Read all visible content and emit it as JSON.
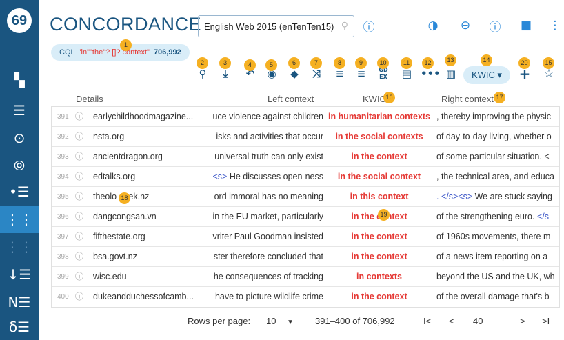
{
  "sidebar": {
    "logo": "69",
    "items": [
      {
        "icon": "dashboard-icon",
        "glyph": "▚"
      },
      {
        "icon": "list-icon",
        "glyph": "☰"
      },
      {
        "icon": "target-icon",
        "glyph": "⊙"
      },
      {
        "icon": "nodes-icon",
        "glyph": "⦾"
      },
      {
        "icon": "bullet-list-icon",
        "glyph": "•☰"
      },
      {
        "icon": "concordance-icon",
        "glyph": "⋮⋮"
      },
      {
        "icon": "parallel-icon",
        "glyph": "⋮⋮"
      },
      {
        "icon": "sort-list-icon",
        "glyph": "↓☰"
      },
      {
        "icon": "ngram-icon",
        "glyph": "N☰"
      },
      {
        "icon": "diff-icon",
        "glyph": "δ☰"
      }
    ]
  },
  "header": {
    "title": "CONCORDANCE",
    "corpus": "English Web 2015 (enTenTen15)",
    "info_glyph": "ⓘ",
    "icons": [
      "contrast-icon",
      "link-icon",
      "help-icon",
      "feedback-icon",
      "more-icon"
    ]
  },
  "query": {
    "cql_label": "CQL",
    "query_text": "\"in\"\"the\"? []? context\"",
    "count": "706,992"
  },
  "toolbar": {
    "kwic_label": "KWIC ▾",
    "gdex_label": "GD EX",
    "badges": [
      "1",
      "2",
      "3",
      "4",
      "5",
      "6",
      "7",
      "8",
      "9",
      "10",
      "11",
      "12",
      "13",
      "14",
      "20",
      "15",
      "16",
      "17",
      "18",
      "19"
    ]
  },
  "table": {
    "headers": {
      "details": "Details",
      "left": "Left context",
      "kwic": "KWIC",
      "right": "Right context"
    },
    "rows": [
      {
        "num": "391",
        "site": "earlychildhoodmagazine...",
        "left": "uce violence against children",
        "kwic": "in humanitarian contexts",
        "right": ", thereby improving the physic"
      },
      {
        "num": "392",
        "site": "nsta.org",
        "left": "isks and activities that occur",
        "kwic": "in the social contexts",
        "right": "of day-to-day living, whether o"
      },
      {
        "num": "393",
        "site": "ancientdragon.org",
        "left": "universal truth can only exist",
        "kwic": "in the context",
        "right": "of some particular situation. <"
      },
      {
        "num": "394",
        "site": "edtalks.org",
        "left_tag": "<s>",
        "left": " He discusses open-ness",
        "kwic": "in the social context",
        "right": ", the technical area, and educa"
      },
      {
        "num": "395",
        "site": "theolo geek.nz",
        "left": "ord immoral has no meaning",
        "kwic": "in this context",
        "right_tag": ". </s><s>",
        "right": " We are stuck saying"
      },
      {
        "num": "396",
        "site": "dangcongsan.vn",
        "left": "in the EU market, particularly",
        "kwic": "in the context",
        "right": "of the strengthening euro. ",
        "right_tag2": "</s"
      },
      {
        "num": "397",
        "site": "fifthestate.org",
        "left": "vriter Paul Goodman insisted",
        "kwic": "in the context",
        "right": "of 1960s movements, there m"
      },
      {
        "num": "398",
        "site": "bsa.govt.nz",
        "left": "ster therefore concluded that",
        "kwic": "in the context",
        "right": "of a news item reporting on a"
      },
      {
        "num": "399",
        "site": "wisc.edu",
        "left": "he consequences of tracking",
        "kwic": "in contexts",
        "right": "beyond the US and the UK, wh"
      },
      {
        "num": "400",
        "site": "dukeandduchessofcamb...",
        "left": "have to picture wildlife crime",
        "kwic": "in the context",
        "right": "of the overall damage that's b"
      }
    ]
  },
  "footer": {
    "rows_per_page_label": "Rows per page:",
    "rows_per_page_value": "10",
    "range": "391–400 of 706,992",
    "first": "I<",
    "prev": "<",
    "page": "40",
    "next": ">",
    "last": ">I"
  }
}
